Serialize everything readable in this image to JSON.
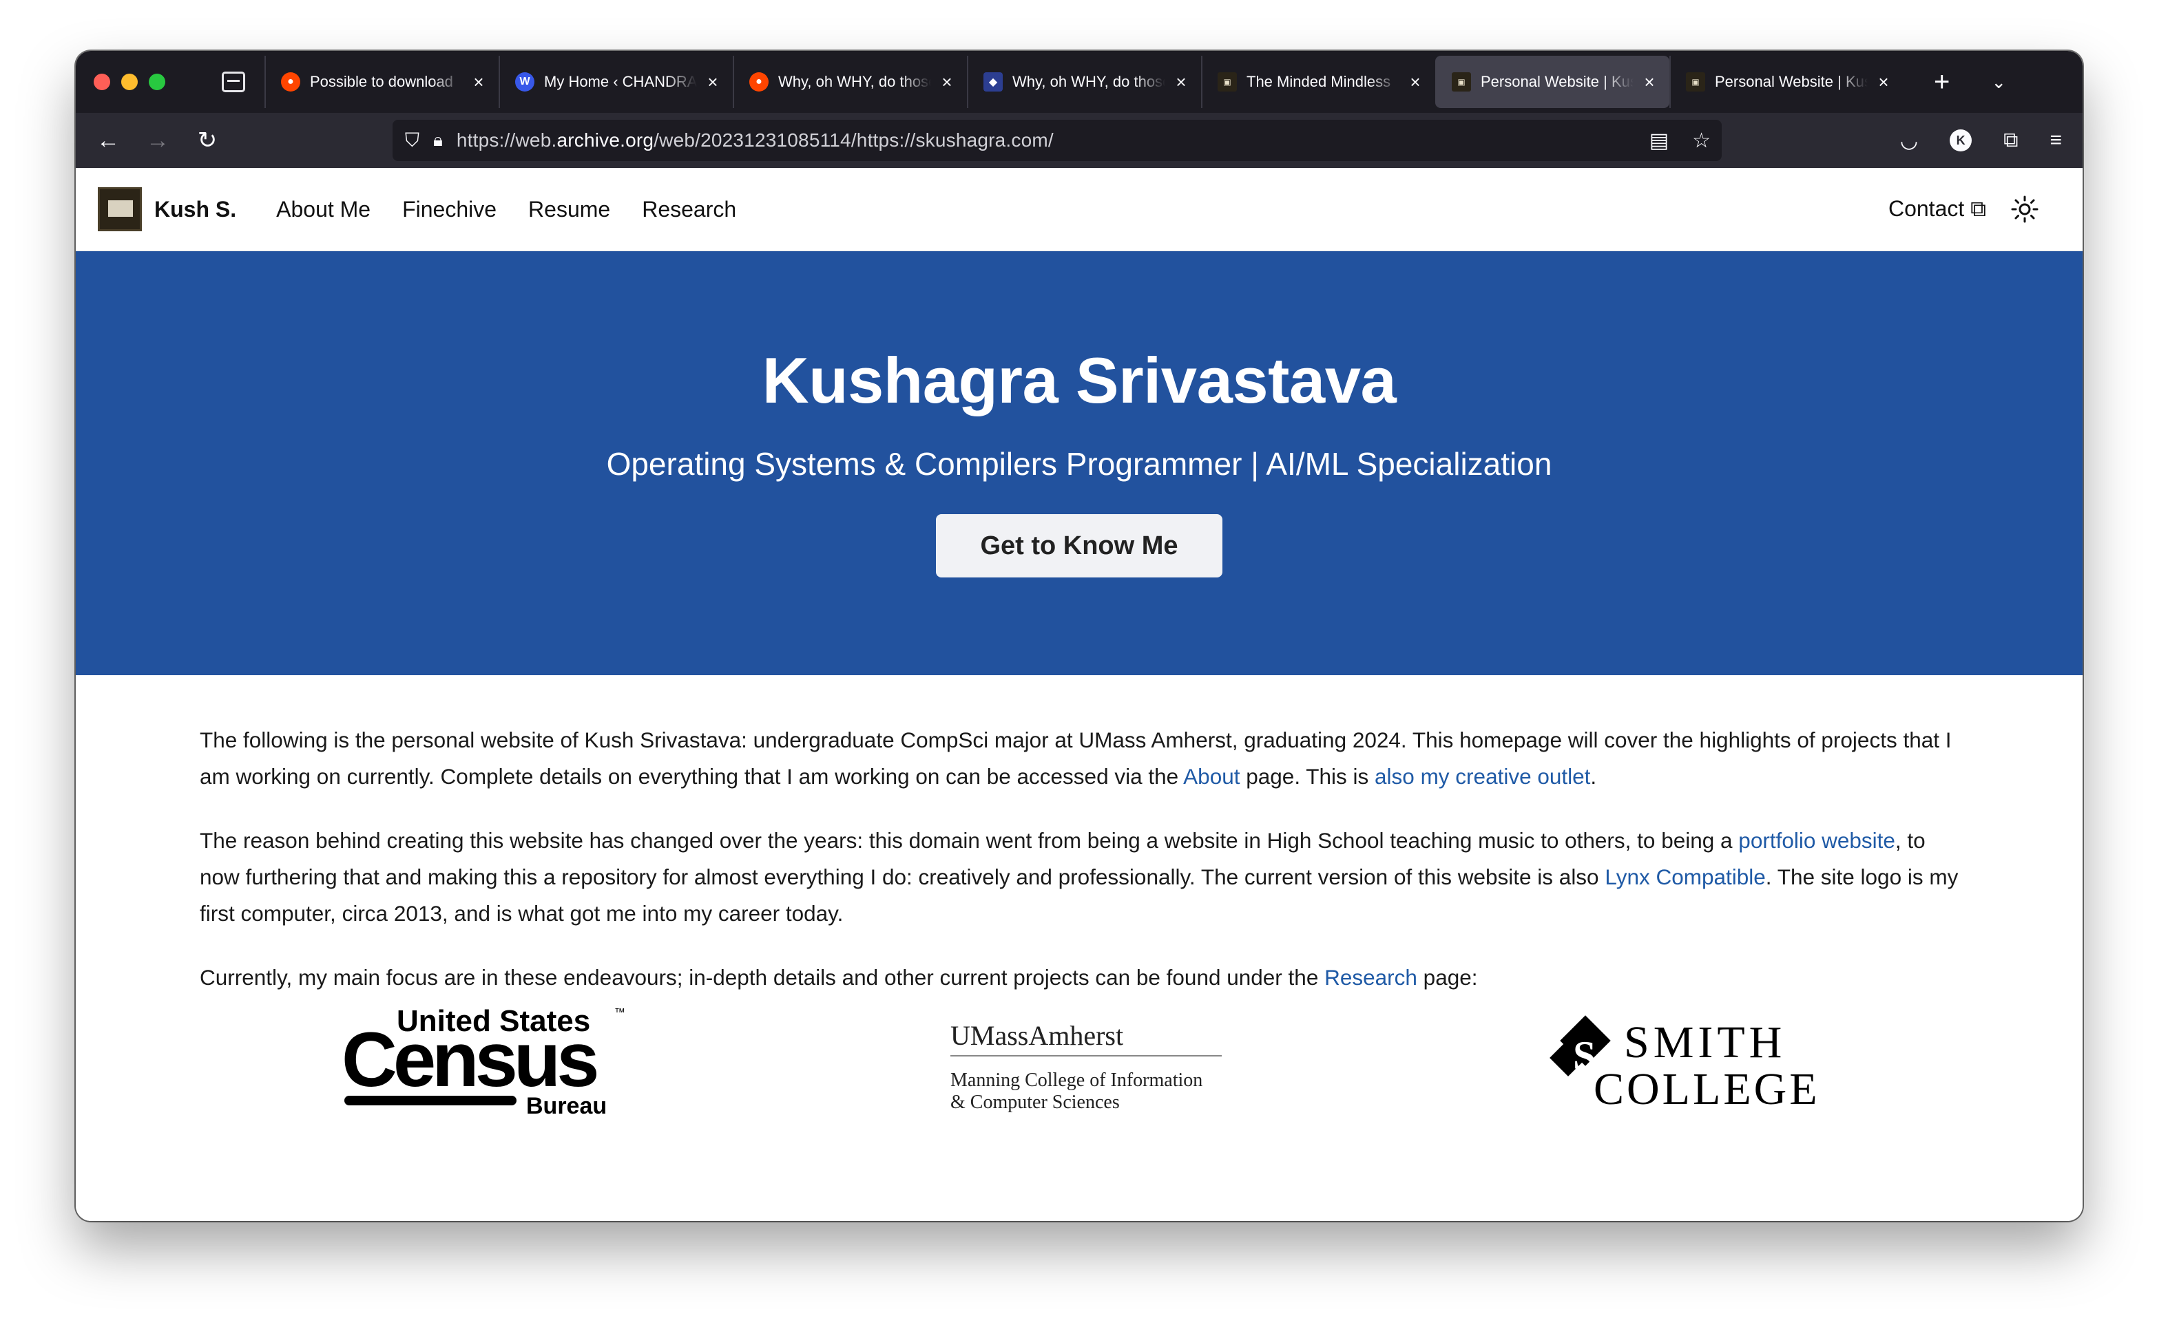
{
  "browser": {
    "tabs": [
      {
        "title": "Possible to download",
        "favicon": "reddit-icon",
        "active": false
      },
      {
        "title": "My Home ‹ CHANDRA",
        "favicon": "wordpress-icon",
        "active": false
      },
      {
        "title": "Why, oh WHY, do those",
        "favicon": "reddit-icon",
        "active": false
      },
      {
        "title": "Why, oh WHY, do those",
        "favicon": "site-icon",
        "active": false
      },
      {
        "title": "The Minded Mindless",
        "favicon": "computer-icon",
        "active": false
      },
      {
        "title": "Personal Website | Kush",
        "favicon": "computer-icon",
        "active": true
      },
      {
        "title": "Personal Website | Kush",
        "favicon": "computer-icon",
        "active": false
      }
    ],
    "url_prefix": "https://web.",
    "url_domain": "archive.org",
    "url_path": "/web/20231231085114/https://skushagra.com/",
    "account_initial": "K"
  },
  "site": {
    "brand": "Kush S.",
    "menu": [
      "About Me",
      "Finechive",
      "Resume",
      "Research"
    ],
    "contact": "Contact"
  },
  "hero": {
    "title": "Kushagra Srivastava",
    "subtitle": "Operating Systems & Compilers Programmer | AI/ML Specialization",
    "cta": "Get to Know Me"
  },
  "content": {
    "p1_a": "The following is the personal website of Kush Srivastava: undergraduate CompSci major at UMass Amherst, graduating 2024. This homepage will cover the highlights of projects that I am working on currently. Complete details on everything that I am working on can be accessed via the ",
    "p1_link1": "About",
    "p1_b": " page. This is ",
    "p1_link2": "also my creative outlet",
    "p1_c": ".",
    "p2_a": "The reason behind creating this website has changed over the years: this domain went from being a website in High School teaching music to others, to being a ",
    "p2_link1": "portfolio website",
    "p2_b": ", to now furthering that and making this a repository for almost everything I do: creatively and professionally. The current version of this website is also ",
    "p2_link2": "Lynx Compatible",
    "p2_c": ". The site logo is my first computer, circa 2013, and is what got me into my career today.",
    "p3_a": "Currently, my main focus are in these endeavours; in-depth details and other current projects can be found under the ",
    "p3_link": "Research",
    "p3_b": " page:"
  },
  "logos": {
    "census_top": "United States",
    "census_main": "Census",
    "census_tm": "™",
    "census_bottom": "Bureau",
    "umass_name": "UMassAmherst",
    "umass_line1": "Manning College of Information",
    "umass_line2": "& Computer Sciences",
    "smith_line1": "SMITH",
    "smith_line2": "COLLEGE"
  },
  "colors": {
    "hero_bg": "#22529e",
    "link": "#1f5aa6",
    "tabstrip": "#1c1b22",
    "navbar": "#2b2a33"
  }
}
